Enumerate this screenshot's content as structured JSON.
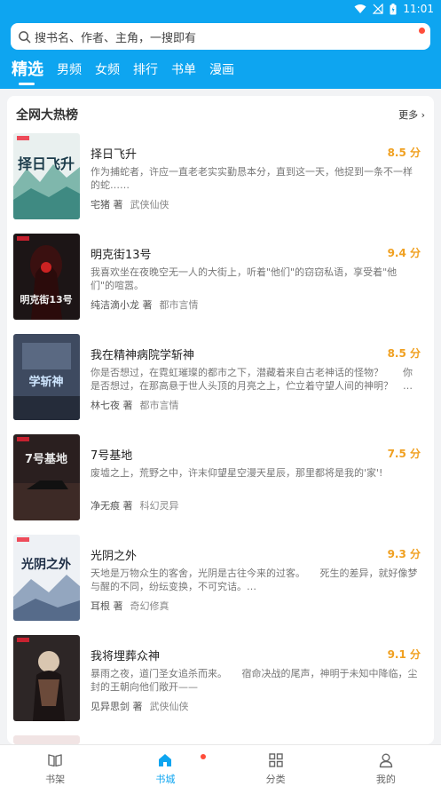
{
  "status_bar": {
    "time": "11:01",
    "icons": [
      "wifi-icon",
      "signal-off-icon",
      "battery-charging-icon"
    ]
  },
  "search": {
    "placeholder": "搜书名、作者、主角，一搜即有",
    "icon": "search-icon"
  },
  "tabs": [
    {
      "label": "精选",
      "active": true
    },
    {
      "label": "男频",
      "active": false
    },
    {
      "label": "女频",
      "active": false
    },
    {
      "label": "排行",
      "active": false
    },
    {
      "label": "书单",
      "active": false
    },
    {
      "label": "漫画",
      "active": false
    }
  ],
  "ranking": {
    "title": "全网大热榜",
    "more_label": "更多",
    "books": [
      {
        "title": "择日飞升",
        "score": "8.5 分",
        "desc": "作为捕蛇者，许应一直老老实实勤恳本分，直到这一天，他捉到一条不一样的蛇……",
        "author": "宅猪 著",
        "category": "武侠仙侠",
        "cover_text": "择日飞升"
      },
      {
        "title": "明克街13号",
        "score": "9.4 分",
        "desc": "我喜欢坐在夜晚空无一人的大街上，听着\"他们\"的窃窃私语，享受着\"他们\"的喧嚣。",
        "author": "纯洁滴小龙 著",
        "category": "都市言情",
        "cover_text": "明克街13号"
      },
      {
        "title": "我在精神病院学斩神",
        "score": "8.5 分",
        "desc": "你是否想过，在霓虹璀璨的都市之下，潜藏着来自古老神话的怪物？　　你是否想过，在那高悬于世人头顶的月亮之上，伫立着守望人间的神明？　…",
        "author": "林七夜 著",
        "category": "都市言情",
        "cover_text": "学斩神"
      },
      {
        "title": "7号基地",
        "score": "7.5 分",
        "desc": "废墟之上，荒野之中，许末仰望星空漫天星辰，那里都将是我的'家'!",
        "author": "净无痕 著",
        "category": "科幻灵异",
        "cover_text": "7号基地"
      },
      {
        "title": "光阴之外",
        "score": "9.3 分",
        "desc": "天地是万物众生的客舍，光阴是古往今来的过客。　　死生的差异，就好像梦与醒的不同，纷纭变换，不可究诘。…",
        "author": "耳根 著",
        "category": "奇幻修真",
        "cover_text": "光阴之外"
      },
      {
        "title": "我将埋葬众神",
        "score": "9.1 分",
        "desc": "暴雨之夜，道门圣女追杀而来。　　宿命决战的尾声，神明于未知中降临，尘封的王朝向他们敞开——",
        "author": "见异思剑 著",
        "category": "武侠仙侠",
        "cover_text": ""
      }
    ]
  },
  "bottom_nav": [
    {
      "label": "书架",
      "icon": "bookshelf-icon",
      "active": false
    },
    {
      "label": "书城",
      "icon": "home-icon",
      "active": true
    },
    {
      "label": "分类",
      "icon": "category-grid-icon",
      "active": false
    },
    {
      "label": "我的",
      "icon": "user-icon",
      "active": false
    }
  ],
  "colors": {
    "accent": "#0ea5f0",
    "score": "#f0a020",
    "badge": "#ff4d3a"
  }
}
